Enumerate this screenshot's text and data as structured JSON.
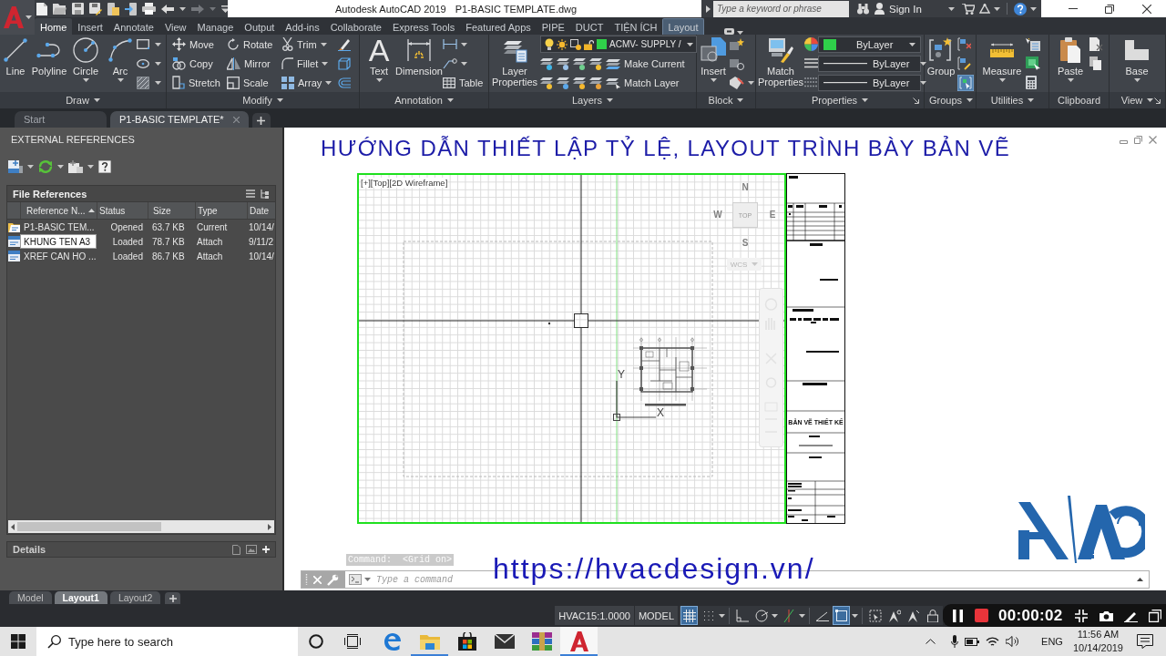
{
  "title_bar": {
    "app": "Autodesk AutoCAD 2019",
    "file": "P1-BASIC TEMPLATE.dwg",
    "search": {
      "placeholder": "Type a keyword or phrase"
    },
    "sign_in": "Sign In"
  },
  "ribbon_tabs": [
    {
      "label": "Home",
      "selected": true,
      "kind": "standard"
    },
    {
      "label": "Insert",
      "selected": false,
      "kind": "standard"
    },
    {
      "label": "Annotate",
      "selected": false,
      "kind": "standard"
    },
    {
      "label": "View",
      "selected": false,
      "kind": "standard"
    },
    {
      "label": "Manage",
      "selected": false,
      "kind": "standard"
    },
    {
      "label": "Output",
      "selected": false,
      "kind": "standard"
    },
    {
      "label": "Add-ins",
      "selected": false,
      "kind": "standard"
    },
    {
      "label": "Collaborate",
      "selected": false,
      "kind": "standard"
    },
    {
      "label": "Express Tools",
      "selected": false,
      "kind": "standard"
    },
    {
      "label": "Featured Apps",
      "selected": false,
      "kind": "standard"
    },
    {
      "label": "PIPE",
      "selected": false,
      "kind": "standard"
    },
    {
      "label": "DUCT",
      "selected": false,
      "kind": "standard"
    },
    {
      "label": "TIỆN ÍCH",
      "selected": false,
      "kind": "standard"
    },
    {
      "label": "Layout",
      "selected": false,
      "kind": "contextual"
    }
  ],
  "ribbon_panels": [
    {
      "title": "Draw",
      "tools": [
        "Line",
        "Polyline",
        "Circle",
        "Arc"
      ]
    },
    {
      "title": "Modify",
      "tools": [
        "Move",
        "Rotate",
        "Trim",
        "Copy",
        "Mirror",
        "Fillet",
        "Stretch",
        "Scale",
        "Array"
      ]
    },
    {
      "title": "Annotation",
      "text_glyph": "A",
      "tools": [
        "Text",
        "Dimension",
        "Table"
      ]
    },
    {
      "title": "Layers",
      "tools": [
        "Layer Properties",
        "Make Current",
        "Match Layer"
      ],
      "current_layer": "ACMV- SUPPLY /"
    },
    {
      "title": "Block",
      "tools": [
        "Insert"
      ]
    },
    {
      "title": "Properties",
      "tools": [
        "Match Properties"
      ],
      "dropdowns": [
        "ByLayer",
        "ByLayer",
        "ByLayer"
      ]
    },
    {
      "title": "Groups",
      "tools": [
        "Group"
      ],
      "selection_toggle_on": true
    },
    {
      "title": "Utilities",
      "tools": [
        "Measure"
      ]
    },
    {
      "title": "Clipboard",
      "tools": [
        "Paste"
      ]
    },
    {
      "title": "View",
      "tools": [
        "Base"
      ]
    }
  ],
  "document_tabs": [
    {
      "label": "Start",
      "selected": false
    },
    {
      "label": "P1-BASIC TEMPLATE*",
      "selected": true
    }
  ],
  "xref_palette": {
    "title": "EXTERNAL REFERENCES",
    "section": "File References",
    "columns": [
      {
        "label": "Reference N...",
        "sorted": true
      },
      {
        "label": "Status",
        "sorted": false
      },
      {
        "label": "Size",
        "sorted": false
      },
      {
        "label": "Type",
        "sorted": false
      },
      {
        "label": "Date",
        "sorted": false
      }
    ],
    "rows": [
      {
        "kind": "current",
        "name": "P1-BASIC TEM...",
        "status": "Opened",
        "size": "63.7 KB",
        "type": "Current",
        "date": "10/14/",
        "selected": false
      },
      {
        "kind": "attached",
        "name": "KHUNG TEN A3",
        "status": "Loaded",
        "size": "78.7 KB",
        "type": "Attach",
        "date": "9/11/2",
        "selected": true
      },
      {
        "kind": "attached",
        "name": "XREF CAN HO ...",
        "status": "Loaded",
        "size": "86.7 KB",
        "type": "Attach",
        "date": "10/14/",
        "selected": false
      }
    ],
    "details": "Details"
  },
  "drawing": {
    "overlay_title": "HƯỚNG DẪN THIẾT LẬP TỶ LỆ, LAYOUT TRÌNH BÀY BẢN VẼ",
    "viewport": {
      "label": "[+][Top][2D Wireframe]",
      "compass": [
        "N",
        "W",
        "E",
        "S"
      ],
      "viewcube": "TOP",
      "ucs_name": "WCS",
      "axis_x": "X",
      "axis_y": "Y"
    },
    "title_block": {
      "drawing_title": "BẢN VẼ THIẾT KẾ"
    }
  },
  "command_line": {
    "history": "Command:  <Grid on>",
    "placeholder": "Type a command"
  },
  "overlay_url": "https://hvacdesign.vn/",
  "layout_tabs": [
    {
      "label": "Model",
      "selected": false
    },
    {
      "label": "Layout1",
      "selected": true
    },
    {
      "label": "Layout2",
      "selected": false
    }
  ],
  "status_bar": {
    "scale": "HVAC15:1.0000",
    "space": "MODEL",
    "toggles": [
      {
        "on": true
      },
      {
        "on": false
      },
      {
        "on": false
      },
      {
        "on": false
      },
      {
        "on": false
      },
      {
        "on": false
      },
      {
        "on": true
      },
      {
        "on": false
      },
      {
        "on": false
      },
      {
        "on": false
      },
      {
        "on": false
      }
    ]
  },
  "recorder": {
    "time": "00:00:02"
  },
  "taskbar": {
    "search": {
      "placeholder": "Type here to search"
    },
    "apps": [
      {
        "running": false,
        "selected": false
      },
      {
        "running": true,
        "selected": false
      },
      {
        "running": false,
        "selected": false
      },
      {
        "running": false,
        "selected": false
      },
      {
        "running": false,
        "selected": false
      },
      {
        "running": true,
        "selected": true
      }
    ],
    "language": "ENG",
    "time": "11:56 AM",
    "date": "10/14/2019"
  }
}
